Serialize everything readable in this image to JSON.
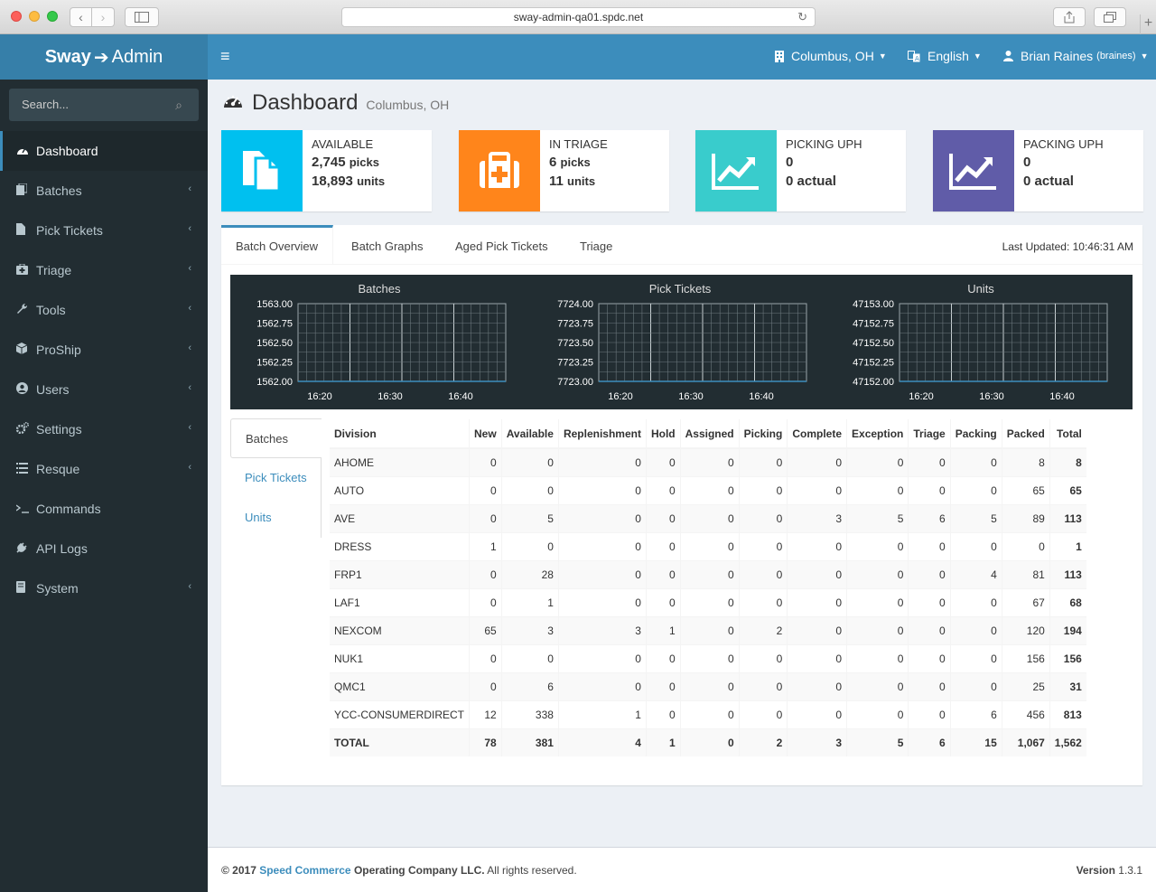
{
  "browser": {
    "url": "sway-admin-qa01.spdc.net"
  },
  "app": {
    "logo_bold": "Sway",
    "logo_light": "Admin",
    "logo_arrow": "➔"
  },
  "topbar": {
    "location": "Columbus, OH",
    "language": "English",
    "user_name": "Brian Raines",
    "user_login": "(braines)"
  },
  "sidebar": {
    "search_placeholder": "Search...",
    "items": [
      {
        "label": "Dashboard",
        "icon": "dashboard-icon",
        "active": true,
        "chevron": false
      },
      {
        "label": "Batches",
        "icon": "batches-icon",
        "active": false,
        "chevron": true
      },
      {
        "label": "Pick Tickets",
        "icon": "file-icon",
        "active": false,
        "chevron": true
      },
      {
        "label": "Triage",
        "icon": "medkit-icon",
        "active": false,
        "chevron": true
      },
      {
        "label": "Tools",
        "icon": "wrench-icon",
        "active": false,
        "chevron": true
      },
      {
        "label": "ProShip",
        "icon": "cube-icon",
        "active": false,
        "chevron": true
      },
      {
        "label": "Users",
        "icon": "user-circle-icon",
        "active": false,
        "chevron": true
      },
      {
        "label": "Settings",
        "icon": "gears-icon",
        "active": false,
        "chevron": true
      },
      {
        "label": "Resque",
        "icon": "list-icon",
        "active": false,
        "chevron": true
      },
      {
        "label": "Commands",
        "icon": "terminal-icon",
        "active": false,
        "chevron": false
      },
      {
        "label": "API Logs",
        "icon": "plug-icon",
        "active": false,
        "chevron": false
      },
      {
        "label": "System",
        "icon": "server-icon",
        "active": false,
        "chevron": true
      }
    ]
  },
  "page": {
    "title": "Dashboard",
    "subtitle": "Columbus, OH"
  },
  "info_boxes": [
    {
      "label": "AVAILABLE",
      "line1_value": "2,745",
      "line1_unit": "picks",
      "line2_value": "18,893",
      "line2_unit": "units",
      "color": "#00c0ef",
      "icon": "files-icon"
    },
    {
      "label": "IN TRIAGE",
      "line1_value": "6",
      "line1_unit": "picks",
      "line2_value": "11",
      "line2_unit": "units",
      "color": "#ff851b",
      "icon": "medkit-icon"
    },
    {
      "label": "PICKING UPH",
      "line1_value": "0",
      "line1_unit": "",
      "line2_value": "0 actual",
      "line2_unit": "",
      "color": "#39cccc",
      "icon": "line-chart-icon"
    },
    {
      "label": "PACKING UPH",
      "line1_value": "0",
      "line1_unit": "",
      "line2_value": "0 actual",
      "line2_unit": "",
      "color": "#605ca8",
      "icon": "line-chart-icon"
    }
  ],
  "tabs": {
    "items": [
      "Batch Overview",
      "Batch Graphs",
      "Aged Pick Tickets",
      "Triage"
    ],
    "active": 0,
    "last_updated": "Last Updated: 10:46:31 AM"
  },
  "chart_data": [
    {
      "type": "line",
      "title": "Batches",
      "y_ticks": [
        "1563.00",
        "1562.75",
        "1562.50",
        "1562.25",
        "1562.00"
      ],
      "ylim": [
        1562.0,
        1563.0
      ],
      "x_ticks": [
        "16:20",
        "16:30",
        "16:40"
      ],
      "series": [],
      "grid": true
    },
    {
      "type": "line",
      "title": "Pick Tickets",
      "y_ticks": [
        "7724.00",
        "7723.75",
        "7723.50",
        "7723.25",
        "7723.00"
      ],
      "ylim": [
        7723.0,
        7724.0
      ],
      "x_ticks": [
        "16:20",
        "16:30",
        "16:40"
      ],
      "series": [],
      "grid": true
    },
    {
      "type": "line",
      "title": "Units",
      "y_ticks": [
        "47153.00",
        "47152.75",
        "47152.50",
        "47152.25",
        "47152.00"
      ],
      "ylim": [
        47152.0,
        47153.0
      ],
      "x_ticks": [
        "16:20",
        "16:30",
        "16:40"
      ],
      "series": [],
      "grid": true
    }
  ],
  "vtabs": {
    "items": [
      "Batches",
      "Pick Tickets",
      "Units"
    ],
    "active": 0
  },
  "table": {
    "columns": [
      "Division",
      "New",
      "Available",
      "Replenishment",
      "Hold",
      "Assigned",
      "Picking",
      "Complete",
      "Exception",
      "Triage",
      "Packing",
      "Packed",
      "Total"
    ],
    "rows": [
      [
        "AHOME",
        "0",
        "0",
        "0",
        "0",
        "0",
        "0",
        "0",
        "0",
        "0",
        "0",
        "8",
        "8"
      ],
      [
        "AUTO",
        "0",
        "0",
        "0",
        "0",
        "0",
        "0",
        "0",
        "0",
        "0",
        "0",
        "65",
        "65"
      ],
      [
        "AVE",
        "0",
        "5",
        "0",
        "0",
        "0",
        "0",
        "3",
        "5",
        "6",
        "5",
        "89",
        "113"
      ],
      [
        "DRESS",
        "1",
        "0",
        "0",
        "0",
        "0",
        "0",
        "0",
        "0",
        "0",
        "0",
        "0",
        "1"
      ],
      [
        "FRP1",
        "0",
        "28",
        "0",
        "0",
        "0",
        "0",
        "0",
        "0",
        "0",
        "4",
        "81",
        "113"
      ],
      [
        "LAF1",
        "0",
        "1",
        "0",
        "0",
        "0",
        "0",
        "0",
        "0",
        "0",
        "0",
        "67",
        "68"
      ],
      [
        "NEXCOM",
        "65",
        "3",
        "3",
        "1",
        "0",
        "2",
        "0",
        "0",
        "0",
        "0",
        "120",
        "194"
      ],
      [
        "NUK1",
        "0",
        "0",
        "0",
        "0",
        "0",
        "0",
        "0",
        "0",
        "0",
        "0",
        "156",
        "156"
      ],
      [
        "QMC1",
        "0",
        "6",
        "0",
        "0",
        "0",
        "0",
        "0",
        "0",
        "0",
        "0",
        "25",
        "31"
      ],
      [
        "YCC-CONSUMERDIRECT",
        "12",
        "338",
        "1",
        "0",
        "0",
        "0",
        "0",
        "0",
        "0",
        "6",
        "456",
        "813"
      ]
    ],
    "total_row": [
      "TOTAL",
      "78",
      "381",
      "4",
      "1",
      "0",
      "2",
      "3",
      "5",
      "6",
      "15",
      "1,067",
      "1,562"
    ]
  },
  "footer": {
    "copy_prefix": "© 2017",
    "company_link": "Speed Commerce",
    "copy_suffix": "Operating Company LLC.",
    "rights": "All rights reserved.",
    "version_label": "Version",
    "version_value": "1.3.1"
  }
}
